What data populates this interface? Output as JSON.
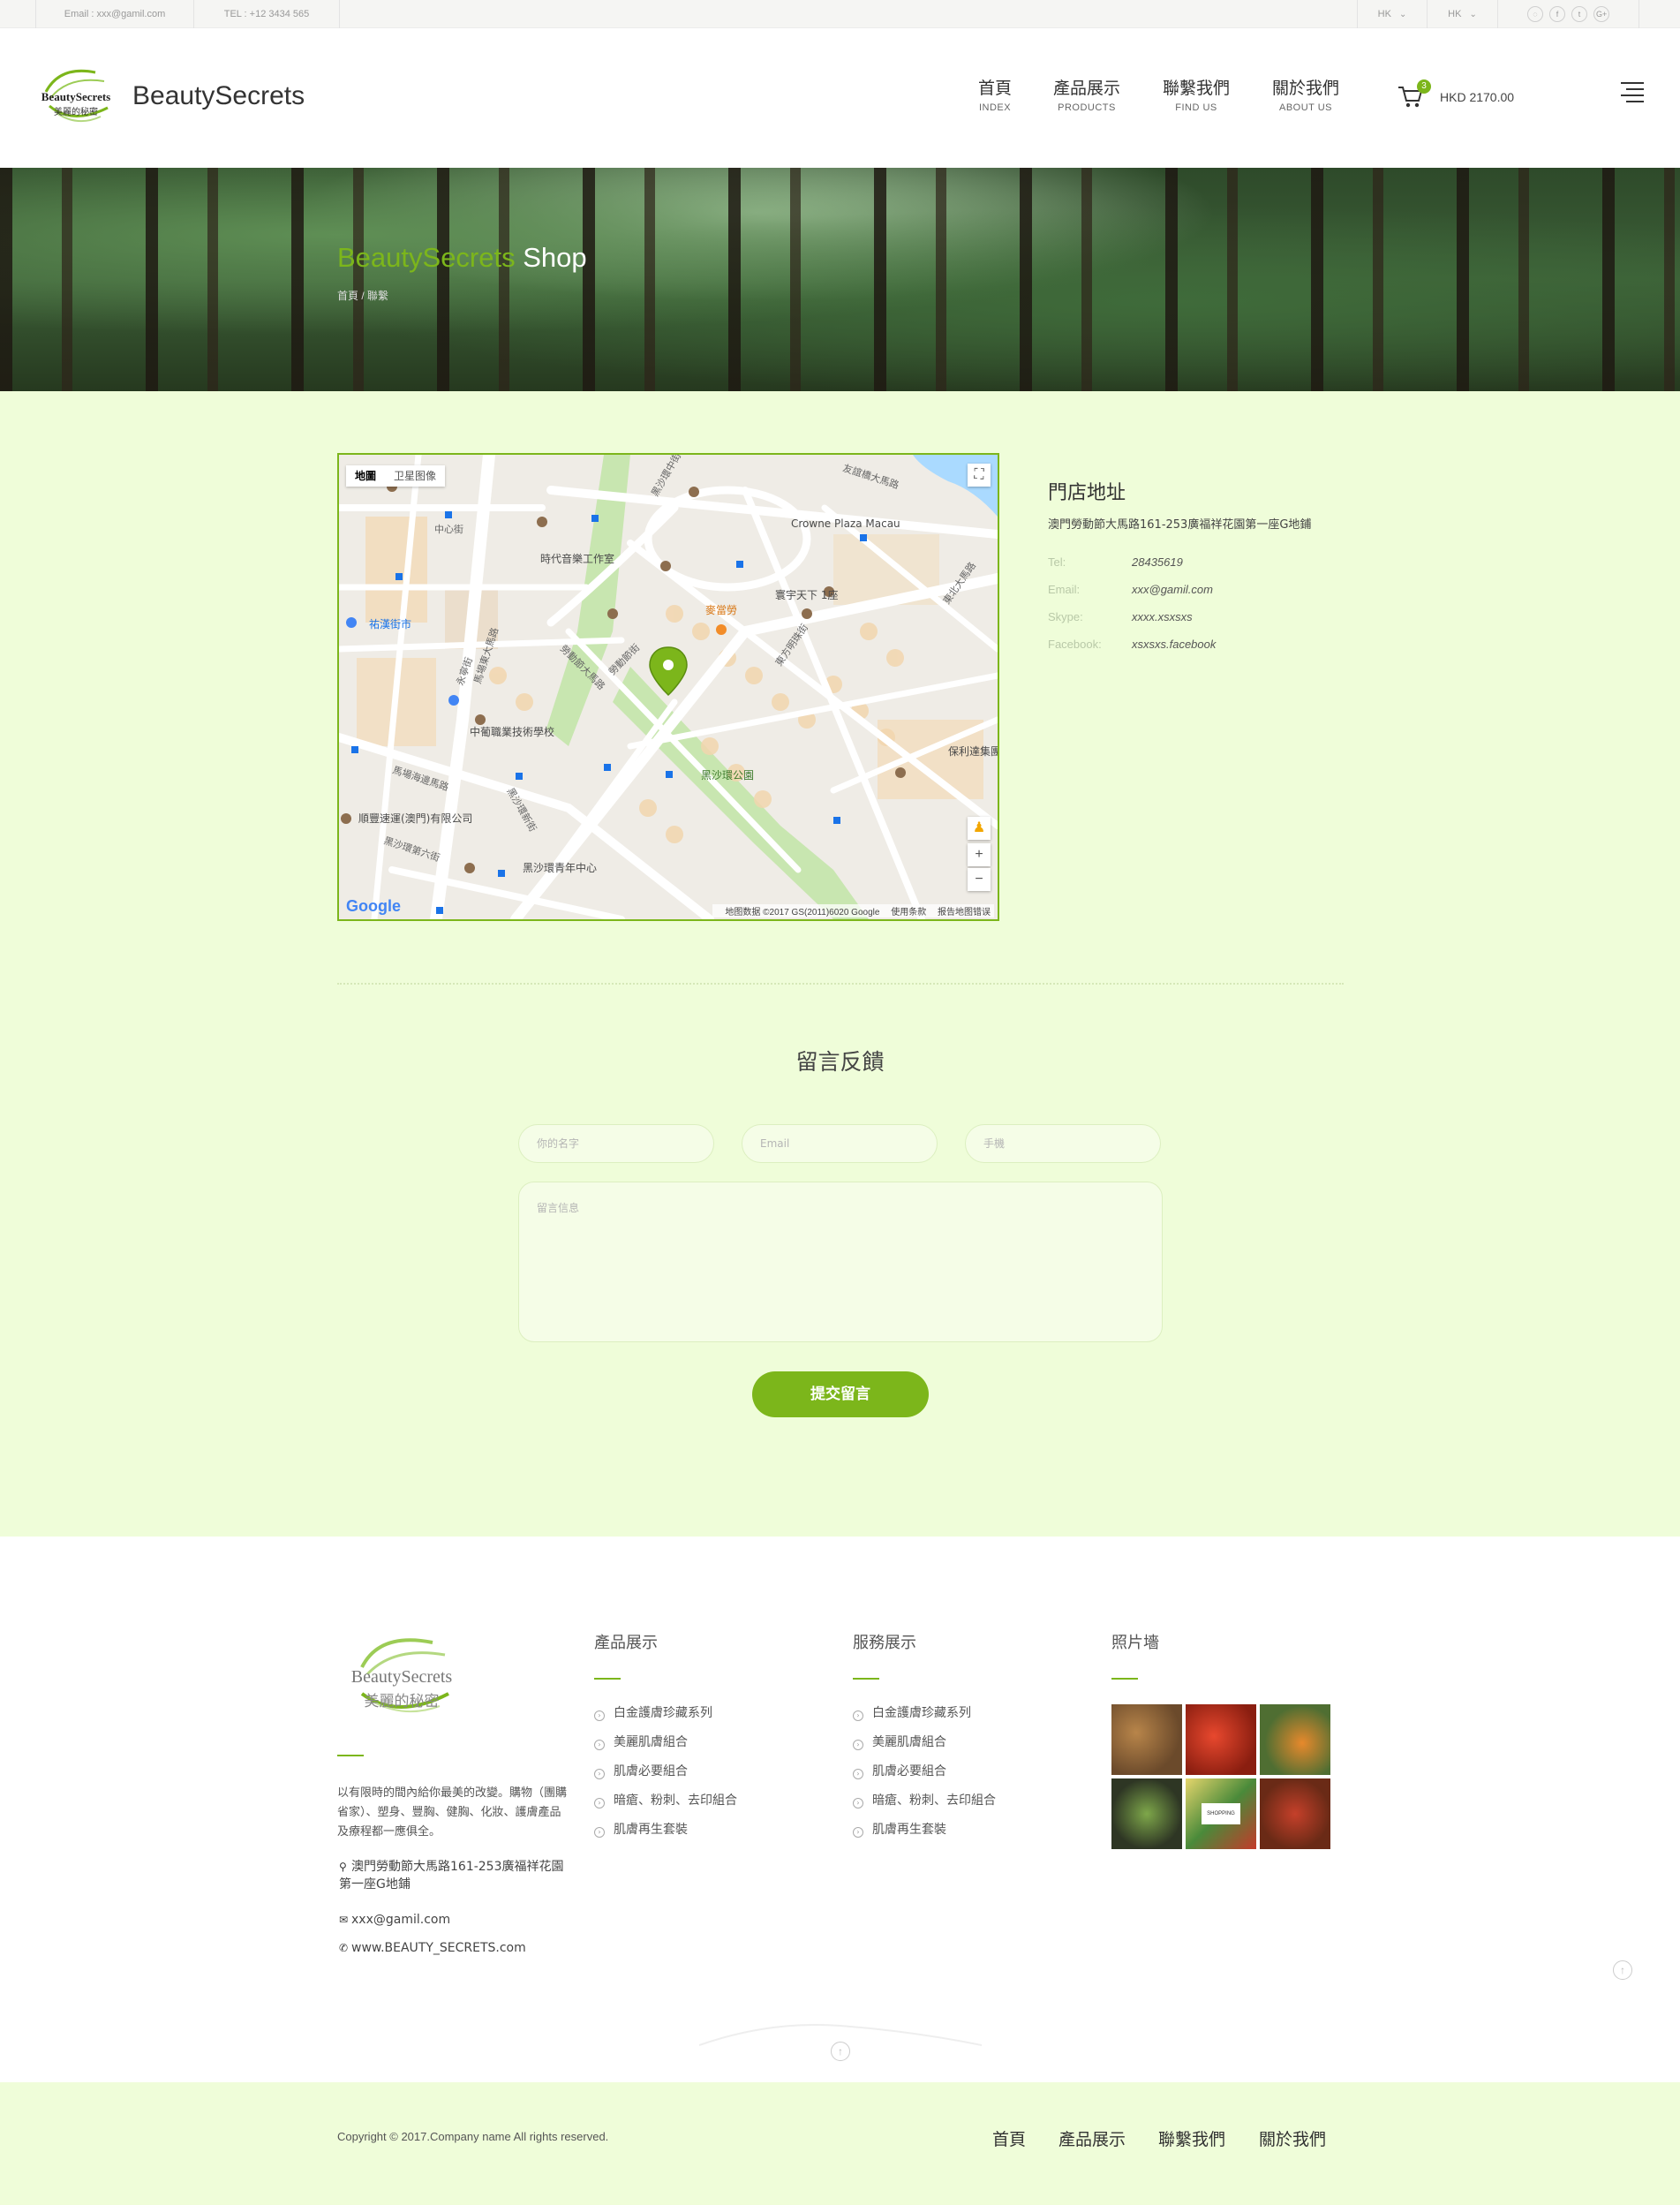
{
  "topbar": {
    "email": "Email : xxx@gamil.com",
    "tel": "TEL : +12 3434 565",
    "lang1": "HK",
    "lang2": "HK",
    "chevron": "⌄",
    "social": {
      "wechat": "◌",
      "facebook": "f",
      "twitter": "t",
      "googleplus": "G+"
    }
  },
  "header": {
    "logo_text": "BeautySecrets",
    "logo_sub": "美麗的秘密",
    "brand": "BeautySecrets",
    "nav": [
      {
        "cn": "首頁",
        "en": "INDEX"
      },
      {
        "cn": "產品展示",
        "en": "PRODUCTS"
      },
      {
        "cn": "聯繫我們",
        "en": "FIND US"
      },
      {
        "cn": "關於我們",
        "en": "ABOUT US"
      }
    ],
    "cart_count": "3",
    "cart_total": "HKD 2170.00"
  },
  "banner": {
    "title_highlight": "BeautySecrets",
    "title_rest": " Shop",
    "breadcrumb": "首頁 / 聯繫"
  },
  "map": {
    "type_map": "地圖",
    "type_satellite": "卫星图像",
    "labels": {
      "crowne": "Crowne Plaza Macau",
      "music": "時代音樂工作室",
      "market": "祐漢街市",
      "school": "中葡職業技術學校",
      "park": "黑沙環公園",
      "mcd": "麥當勞",
      "tower": "寰宇天下 1座",
      "company": "順豐速運(澳門)有限公司",
      "youth": "黑沙環青年中心",
      "poly": "保利達集團",
      "road1": "友誼橋大馬路",
      "road2": "馬場東大馬路",
      "road3": "勞動節大馬路",
      "road4": "黑沙環中街",
      "road5": "東方明珠街",
      "road6": "中心街",
      "road7": "馬場海邊馬路",
      "road8": "黑沙環新街",
      "road9": "永寧街",
      "road10": "黑沙環第六街",
      "road11": "東北大馬路",
      "road12": "勞動節街"
    },
    "google": "Google",
    "attrib_data": "地图数据 ©2017 GS(2011)6020 Google",
    "attrib_terms": "使用条款",
    "attrib_report": "报告地图错误",
    "zoom_in": "+",
    "zoom_out": "−",
    "fullscreen": "⛶",
    "pegman": "♟"
  },
  "store": {
    "title": "門店地址",
    "address": "澳門勞動節大馬路161-253廣福祥花園第一座G地鋪",
    "rows": [
      {
        "label": "Tel:",
        "value": "28435619"
      },
      {
        "label": "Email:",
        "value": "xxx@gamil.com"
      },
      {
        "label": "Skype:",
        "value": "xxxx.xsxsxs"
      },
      {
        "label": "Facebook:",
        "value": "xsxsxs.facebook"
      }
    ]
  },
  "feedback": {
    "title": "留言反饋",
    "name_placeholder": "你的名字",
    "email_placeholder": "Email",
    "phone_placeholder": "手機",
    "message_placeholder": "留言信息",
    "submit": "提交留言"
  },
  "footer": {
    "logo_text": "BeautySecrets",
    "logo_sub": "美麗的秘密",
    "description": "以有限時的間內給你最美的改變。購物（團購省家）、塑身、豐胸、健胸、化妝、護膚產品及療程都一應俱全。",
    "address": "澳門勞動節大馬路161-253廣福祥花園第一座G地鋪",
    "email": "xxx@gamil.com",
    "website": "www.BEAUTY_SECRETS.com",
    "products_title": "產品展示",
    "products": [
      "白金護膚珍藏系列",
      "美麗肌膚組合",
      "肌膚必要組合",
      "暗瘡、粉刺、去印組合",
      "肌膚再生套裝"
    ],
    "services_title": "服務展示",
    "services": [
      "白金護膚珍藏系列",
      "美麗肌膚組合",
      "肌膚必要組合",
      "暗瘡、粉刺、去印組合",
      "肌膚再生套裝"
    ],
    "photos_title": "照片墻",
    "photo_colors": [
      "#7a5a3a",
      "#c8321e",
      "#5a7a3a",
      "#3e4a2e",
      "#d8c860",
      "#9a3a22"
    ],
    "photo_label": "SHOPPING"
  },
  "bottombar": {
    "copyright": "Copyright © 2017.Company name All rights reserved.",
    "nav": [
      "首頁",
      "產品展示",
      "聯繫我們",
      "關於我們"
    ]
  },
  "colors": {
    "accent": "#7cb61b",
    "section_bg": "#effdd9"
  }
}
